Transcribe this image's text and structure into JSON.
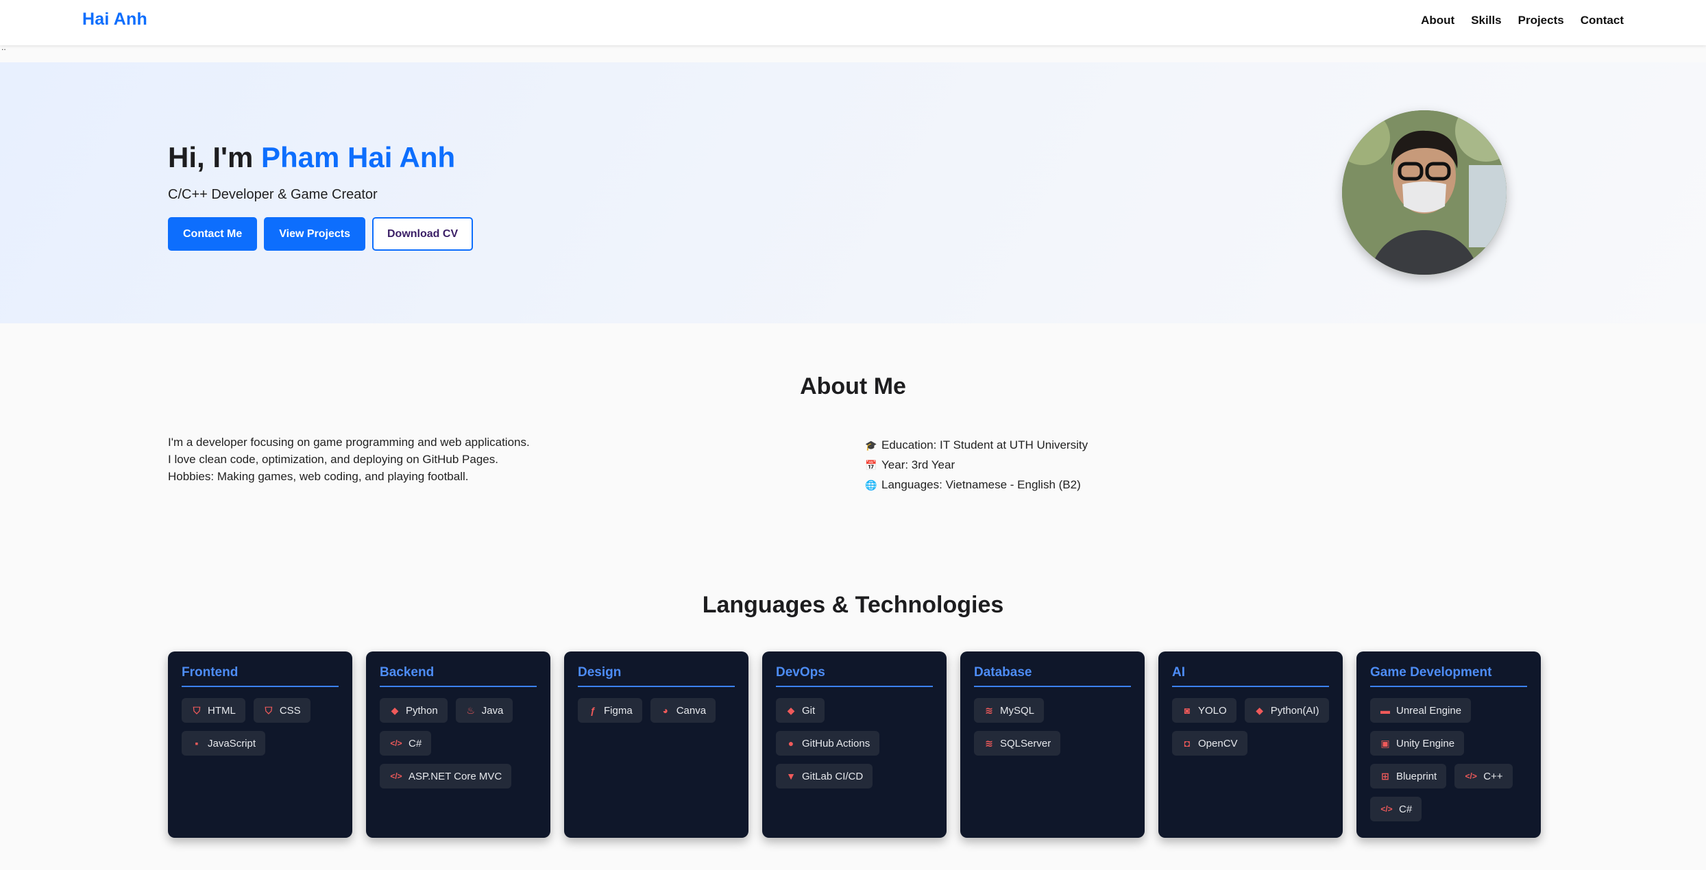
{
  "nav": {
    "brand": "Hai Anh",
    "links": [
      "About",
      "Skills",
      "Projects",
      "Contact"
    ]
  },
  "stray_text": "..",
  "hero": {
    "greeting": "Hi, I'm ",
    "name": "Pham Hai Anh",
    "subtitle": "C/C++ Developer & Game Creator",
    "buttons": [
      "Contact Me",
      "View Projects",
      "Download CV"
    ]
  },
  "about": {
    "title": "About Me",
    "lines": [
      "I'm a developer focusing on game programming and web applications.",
      "I love clean code, optimization, and deploying on GitHub Pages.",
      "Hobbies: Making games, web coding, and playing football."
    ],
    "facts": [
      {
        "icon": "graduation-cap-icon",
        "text": "Education: IT Student at UTH University"
      },
      {
        "icon": "calendar-icon",
        "text": "Year: 3rd Year"
      },
      {
        "icon": "globe-icon",
        "text": "Languages: Vietnamese - English (B2)"
      }
    ]
  },
  "skills": {
    "title": "Languages & Technologies",
    "categories": [
      {
        "title": "Frontend",
        "items": [
          {
            "label": "HTML",
            "icon": "html5-icon"
          },
          {
            "label": "CSS",
            "icon": "css3-icon"
          },
          {
            "label": "JavaScript",
            "icon": "javascript-icon"
          }
        ]
      },
      {
        "title": "Backend",
        "items": [
          {
            "label": "Python",
            "icon": "python-icon"
          },
          {
            "label": "Java",
            "icon": "java-icon"
          },
          {
            "label": "C#",
            "icon": "code-icon"
          },
          {
            "label": "ASP.NET Core MVC",
            "icon": "code-icon"
          }
        ]
      },
      {
        "title": "Design",
        "items": [
          {
            "label": "Figma",
            "icon": "figma-icon"
          },
          {
            "label": "Canva",
            "icon": "palette-icon"
          }
        ]
      },
      {
        "title": "DevOps",
        "items": [
          {
            "label": "Git",
            "icon": "git-icon"
          },
          {
            "label": "GitHub Actions",
            "icon": "github-icon"
          },
          {
            "label": "GitLab CI/CD",
            "icon": "gitlab-icon"
          }
        ]
      },
      {
        "title": "Database",
        "items": [
          {
            "label": "MySQL",
            "icon": "database-icon"
          },
          {
            "label": "SQLServer",
            "icon": "database-icon"
          }
        ]
      },
      {
        "title": "AI",
        "items": [
          {
            "label": "YOLO",
            "icon": "robot-icon"
          },
          {
            "label": "Python(AI)",
            "icon": "python-icon"
          },
          {
            "label": "OpenCV",
            "icon": "camera-icon"
          }
        ]
      },
      {
        "title": "Game Development",
        "items": [
          {
            "label": "Unreal Engine",
            "icon": "gamepad-icon"
          },
          {
            "label": "Unity Engine",
            "icon": "cube-icon"
          },
          {
            "label": "Blueprint",
            "icon": "sitemap-icon"
          },
          {
            "label": "C++",
            "icon": "code-icon"
          },
          {
            "label": "C#",
            "icon": "code-icon"
          }
        ]
      }
    ]
  },
  "colors": {
    "accent": "#0d6efd",
    "card_bg": "#0f172a",
    "card_title": "#4d8cf5",
    "tag_bg": "#232a39",
    "tag_icon": "#f05a5a"
  }
}
